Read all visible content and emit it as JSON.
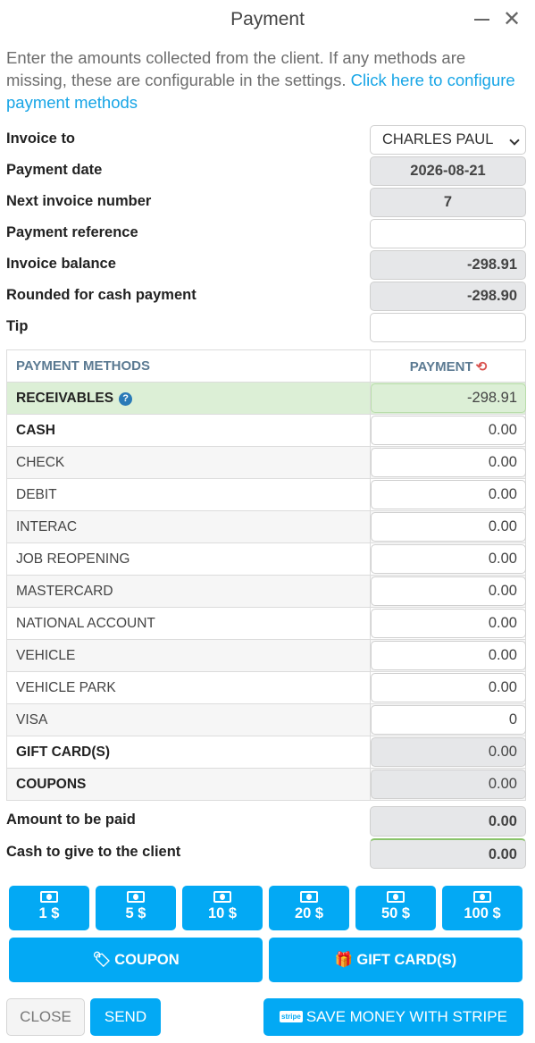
{
  "window": {
    "title": "Payment"
  },
  "intro": {
    "text": "Enter the amounts collected from the client. If any methods are missing, these are configurable in the settings. ",
    "link": "Click here to configure payment methods"
  },
  "fields": {
    "invoice_to": {
      "label": "Invoice to",
      "value": "CHARLES PAUL"
    },
    "payment_date": {
      "label": "Payment date",
      "value": "2026-08-21"
    },
    "next_invoice": {
      "label": "Next invoice number",
      "value": "7"
    },
    "payment_reference": {
      "label": "Payment reference",
      "value": ""
    },
    "invoice_balance": {
      "label": "Invoice balance",
      "value": "-298.91"
    },
    "rounded_cash": {
      "label": "Rounded for cash payment",
      "value": "-298.90"
    },
    "tip": {
      "label": "Tip",
      "value": ""
    }
  },
  "table": {
    "col_methods": "PAYMENT METHODS",
    "col_payment": "PAYMENT",
    "rows": [
      {
        "name": "RECEIVABLES",
        "value": "-298.91"
      },
      {
        "name": "CASH",
        "value": "0.00"
      },
      {
        "name": "CHECK",
        "value": "0.00"
      },
      {
        "name": "DEBIT",
        "value": "0.00"
      },
      {
        "name": "INTERAC",
        "value": "0.00"
      },
      {
        "name": "JOB REOPENING",
        "value": "0.00"
      },
      {
        "name": "MASTERCARD",
        "value": "0.00"
      },
      {
        "name": "NATIONAL ACCOUNT",
        "value": "0.00"
      },
      {
        "name": "VEHICLE",
        "value": "0.00"
      },
      {
        "name": "VEHICLE PARK",
        "value": "0.00"
      },
      {
        "name": "VISA",
        "value": "0"
      },
      {
        "name": "GIFT CARD(S)",
        "value": "0.00"
      },
      {
        "name": "COUPONS",
        "value": "0.00"
      }
    ]
  },
  "summary": {
    "amount_to_pay": {
      "label": "Amount to be paid",
      "value": "0.00"
    },
    "cash_to_give": {
      "label": "Cash to give to the client",
      "value": "0.00"
    }
  },
  "cash_buttons": [
    "1 $",
    "5 $",
    "10 $",
    "20 $",
    "50 $",
    "100 $"
  ],
  "buttons": {
    "coupon": "COUPON",
    "gift_card": "GIFT CARD(S)",
    "close": "CLOSE",
    "send": "SEND",
    "stripe": "SAVE MONEY WITH STRIPE",
    "stripe_logo": "stripe"
  },
  "colors": {
    "accent": "#03a9f4",
    "link": "#17a5e6",
    "receivables_bg": "#dcefd6",
    "refresh": "#d9534f"
  }
}
